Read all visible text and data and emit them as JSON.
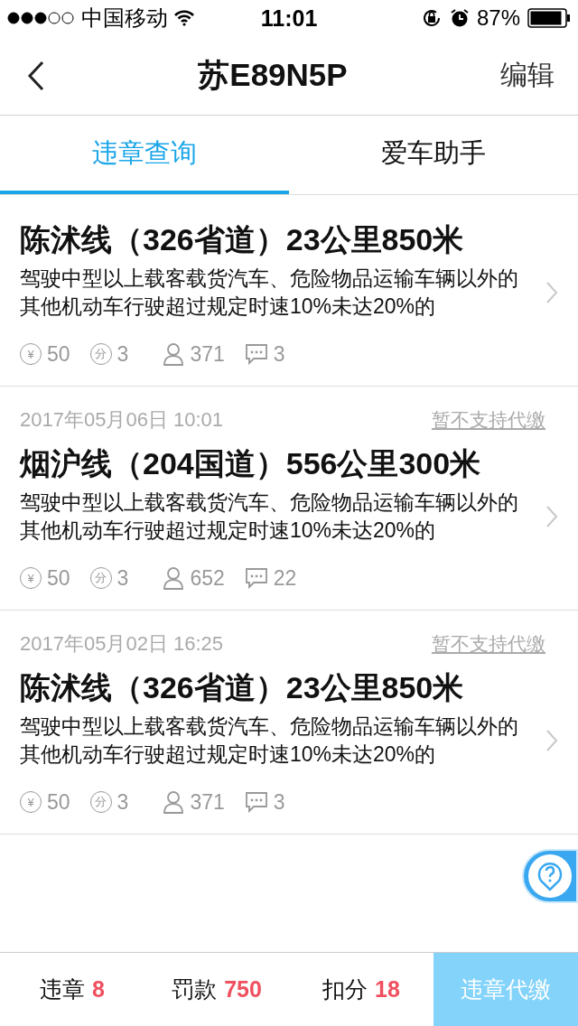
{
  "status_bar": {
    "carrier": "中国移动",
    "time": "11:01",
    "battery": "87%"
  },
  "nav": {
    "title": "苏E89N5P",
    "action": "编辑"
  },
  "tabs": [
    {
      "label": "违章查询",
      "selected": true
    },
    {
      "label": "爱车助手",
      "selected": false
    }
  ],
  "violations": [
    {
      "location": "陈沭线（326省道）23公里850米",
      "description": "驾驶中型以上载客载货汽车、危险物品运输车辆以外的其他机动车行驶超过规定时速10%未达20%的",
      "fine_symbol": "¥",
      "fine": "50",
      "points_symbol": "分",
      "points": "3",
      "views": "371",
      "comments": "3"
    },
    {
      "date": "2017年05月06日 10:01",
      "payment_note": "暂不支持代缴",
      "location": "烟沪线（204国道）556公里300米",
      "description": "驾驶中型以上载客载货汽车、危险物品运输车辆以外的其他机动车行驶超过规定时速10%未达20%的",
      "fine_symbol": "¥",
      "fine": "50",
      "points_symbol": "分",
      "points": "3",
      "views": "652",
      "comments": "22"
    },
    {
      "date": "2017年05月02日 16:25",
      "payment_note": "暂不支持代缴",
      "location": "陈沭线（326省道）23公里850米",
      "description": "驾驶中型以上载客载货汽车、危险物品运输车辆以外的其他机动车行驶超过规定时速10%未达20%的",
      "fine_symbol": "¥",
      "fine": "50",
      "points_symbol": "分",
      "points": "3",
      "views": "371",
      "comments": "3"
    }
  ],
  "summary": [
    {
      "label": "违章",
      "value": "8"
    },
    {
      "label": "罚款",
      "value": "750"
    },
    {
      "label": "扣分",
      "value": "18"
    }
  ],
  "pay_button": "违章代缴"
}
